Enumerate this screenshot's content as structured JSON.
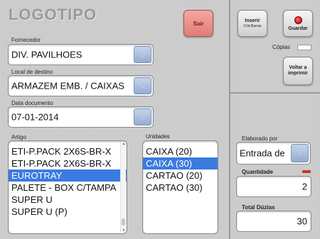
{
  "app": {
    "logo": "LOGOTIPO"
  },
  "buttons": {
    "sair": "Sair",
    "inserir_line1": "Inserir",
    "inserir_line2": "Cód.Barras",
    "guardar": "Guardar",
    "voltar_line1": "Voltar a",
    "voltar_line2": "imprimir"
  },
  "fields": {
    "fornecedor": {
      "label": "Fornecedor",
      "value": "DIV. PAVILHOES"
    },
    "local_destino": {
      "label": "Local de destino",
      "value": "ARMAZEM EMB. / CAIXAS"
    },
    "data_documento": {
      "label": "Data documento",
      "value": "07-01-2014"
    },
    "elaborado_por": {
      "label": "Elaborado por",
      "value": "Entrada de"
    },
    "copias": {
      "label": "Cópias"
    },
    "quantidade": {
      "label": "Quantidade",
      "value": "2"
    },
    "total_duzias": {
      "label": "Total Dúzias",
      "value": "30"
    }
  },
  "artigo": {
    "label": "Artigo",
    "items": [
      "ETI-P.PACK 2X6S-BR-X",
      "ETI-P.PACK 2X6S-BR-X",
      "EUROTRAY",
      "PALETE - BOX C/TAMPA",
      "SUPER U",
      "SUPER U  (P)"
    ],
    "selected_index": 2
  },
  "unidades": {
    "label": "Unidades",
    "items": [
      "CAIXA (20)",
      "CAIXA (30)",
      "CARTAO (20)",
      "CARTAO (30)"
    ],
    "selected_index": 1
  },
  "colors": {
    "selection": "#3b7be0",
    "sair_button": "#e07c77",
    "guardar_indicator": "#b00000",
    "dropdown_arrow": "#94acd2"
  },
  "icons": {
    "dropdown": "chevron-down-icon",
    "guardar": "record-dot-icon",
    "scroll_up": "scroll-up-arrow-icon",
    "scroll_down": "scroll-down-arrow-icon"
  }
}
